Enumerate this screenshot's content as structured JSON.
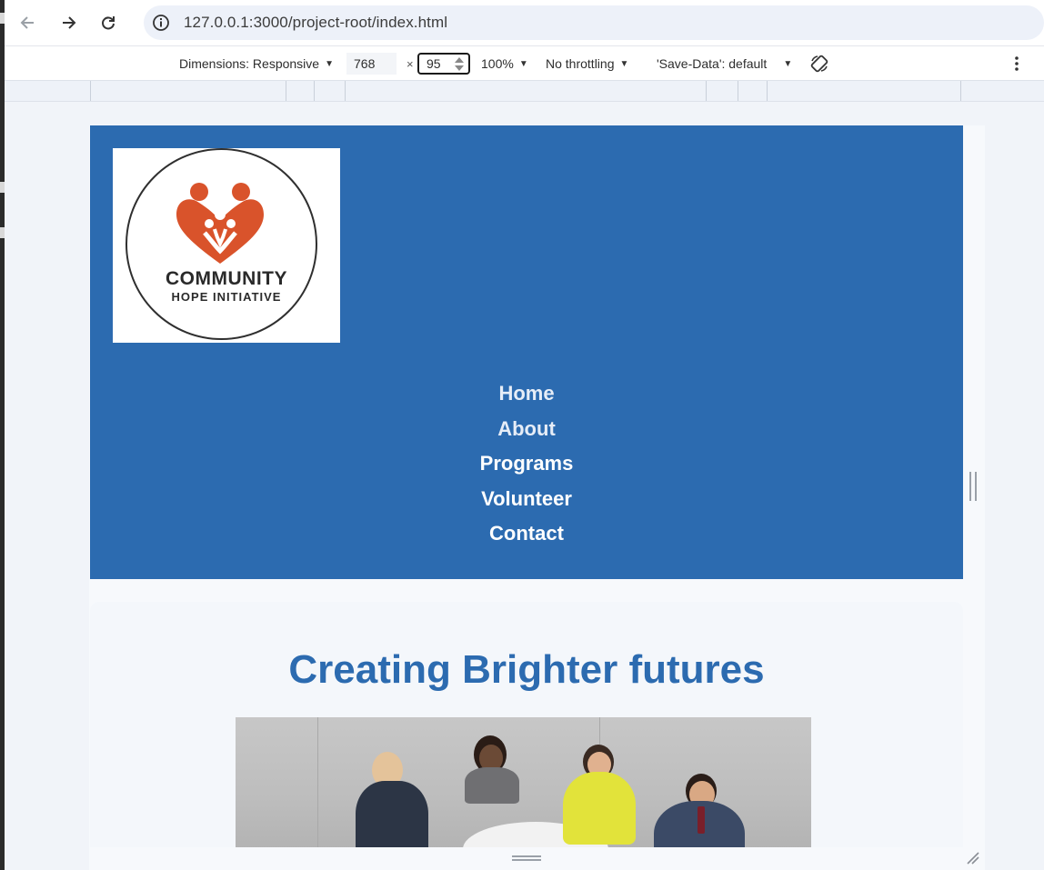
{
  "browser": {
    "url": "127.0.0.1:3000/project-root/index.html"
  },
  "device_toolbar": {
    "dimensions_label": "Dimensions: Responsive",
    "width_value": "768",
    "times": "×",
    "height_value": "95",
    "zoom": "100%",
    "throttling": "No throttling",
    "save_data": "'Save-Data': default"
  },
  "site": {
    "logo": {
      "line1": "COMMUNITY",
      "line2": "HOPE INITIATIVE",
      "brand_color": "#d9532b"
    },
    "nav": [
      {
        "label": "Home"
      },
      {
        "label": "About"
      },
      {
        "label": "Programs"
      },
      {
        "label": "Volunteer"
      },
      {
        "label": "Contact"
      }
    ],
    "headline": "Creating Brighter futures",
    "header_color": "#2c6bb0"
  }
}
